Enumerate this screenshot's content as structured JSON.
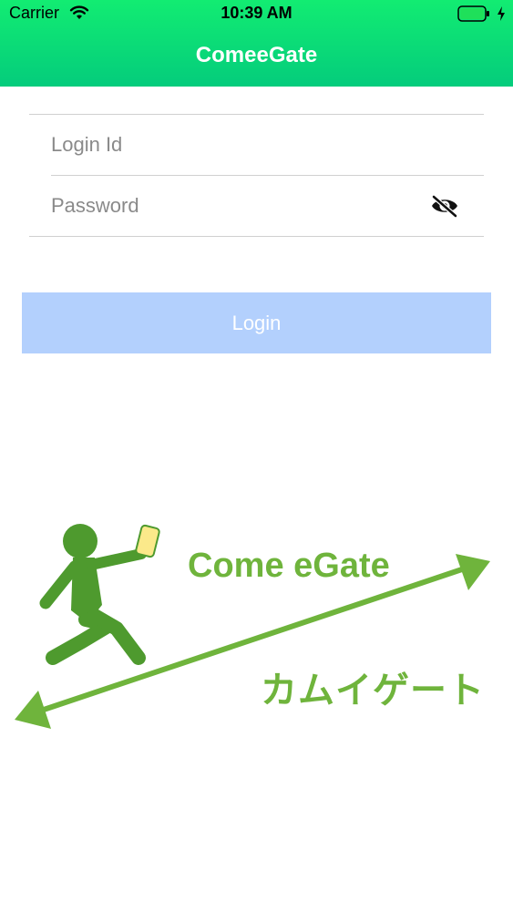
{
  "status_bar": {
    "carrier": "Carrier",
    "time": "10:39 AM",
    "wifi_icon": "wifi-icon",
    "battery_icon": "battery-icon",
    "charging_icon": "charging-bolt-icon"
  },
  "header": {
    "title": "ComeeGate",
    "gradient_top": "#12ec72",
    "gradient_bottom": "#04cc7c"
  },
  "form": {
    "login_id": {
      "placeholder": "Login Id",
      "value": ""
    },
    "password": {
      "placeholder": "Password",
      "value": "",
      "toggle_icon": "eye-slash-icon"
    }
  },
  "login_button": {
    "label": "Login",
    "color": "#b3d0fd"
  },
  "logo": {
    "text_en": "Come eGate",
    "text_jp": "カムイゲート",
    "color": "#6fb43c",
    "figure_icon": "walking-person-with-phone-icon",
    "arrow_icon": "double-headed-arrow-icon"
  }
}
